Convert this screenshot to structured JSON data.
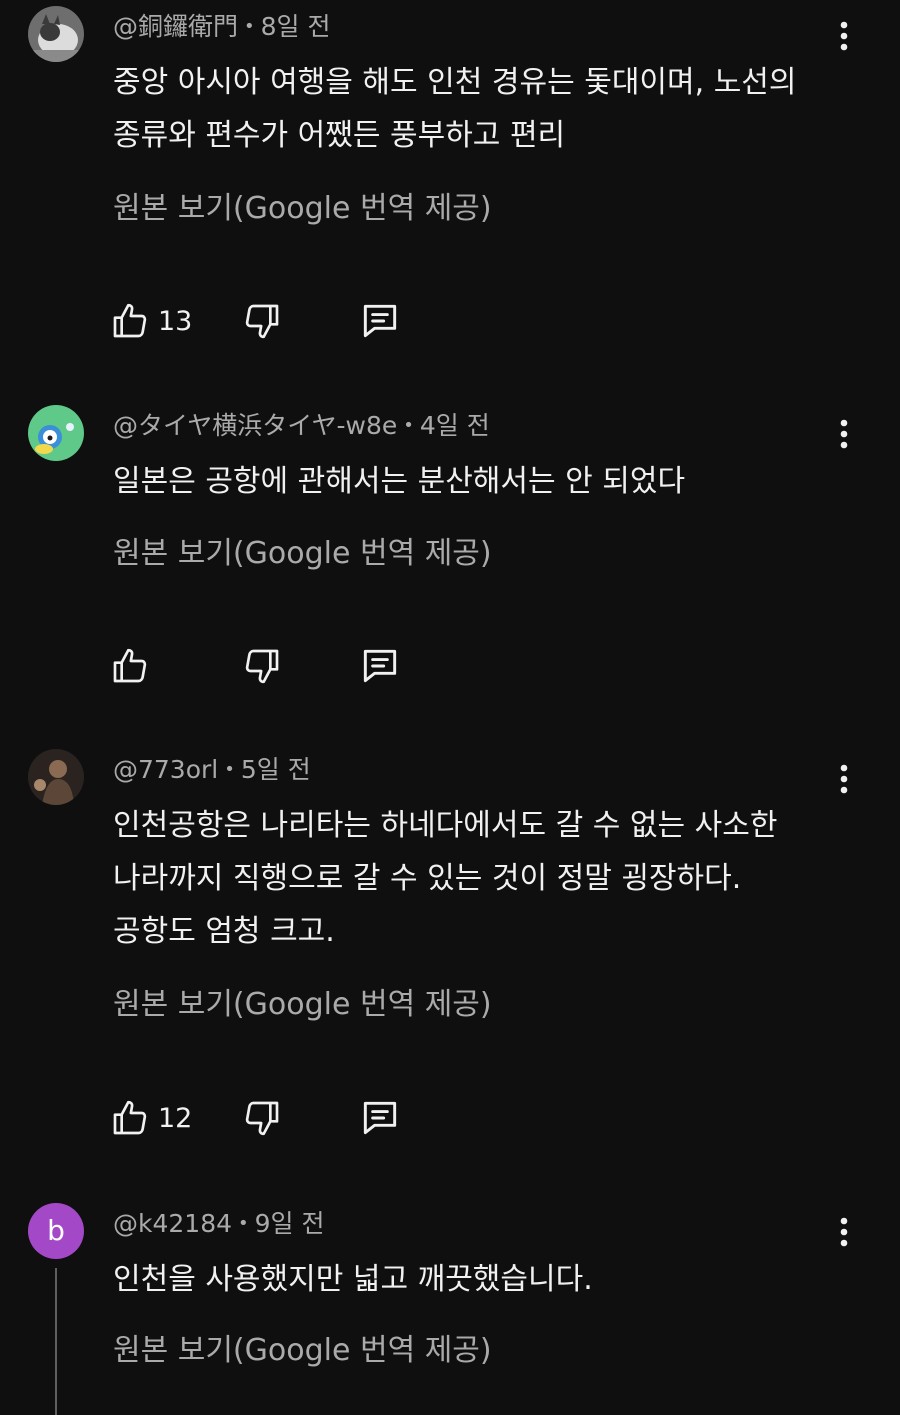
{
  "comments": [
    {
      "author": "@銅鑼衛門",
      "time": "8일 전",
      "text_lines": [
        "중앙 아시아 여행을 해도 인천 경유는 돛대이며, 노선의",
        "종류와 편수가 어쨌든 풍부하고 편리"
      ],
      "translate_label": "원본 보기(Google 번역 제공)",
      "likes": "13"
    },
    {
      "author": "@タイヤ横浜タイヤ-w8e",
      "time": "4일 전",
      "text_lines": [
        "일본은 공항에 관해서는 분산해서는 안 되었다"
      ],
      "translate_label": "원본 보기(Google 번역 제공)",
      "likes": ""
    },
    {
      "author": "@773orl",
      "time": "5일 전",
      "text_lines": [
        "인천공항은 나리타는 하네다에서도 갈 수 없는 사소한",
        "나라까지 직행으로 갈 수 있는 것이 정말 굉장하다.",
        "공항도 엄청 크고."
      ],
      "translate_label": "원본 보기(Google 번역 제공)",
      "likes": "12"
    },
    {
      "author": "@k42184",
      "time": "9일 전",
      "avatar_letter": "b",
      "text_lines": [
        "인천을 사용했지만 넓고 깨끗했습니다."
      ],
      "translate_label": "원본 보기(Google 번역 제공)"
    }
  ],
  "colors": {
    "background": "#0f0f0f",
    "primary_text": "#f1f1f1",
    "secondary_text": "#aaaaaa",
    "avatar_b": "#a349c8"
  },
  "icons": [
    "thumb-up-icon",
    "thumb-down-icon",
    "reply-icon",
    "more-vert-icon"
  ]
}
